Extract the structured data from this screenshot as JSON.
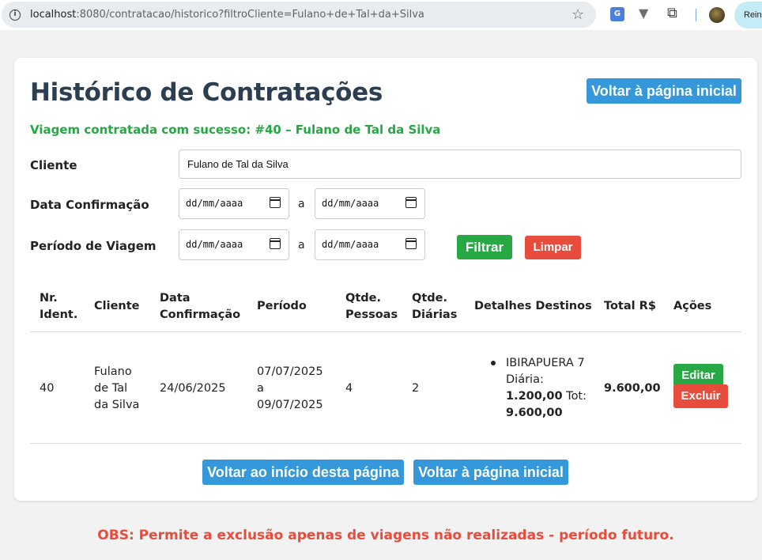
{
  "browser": {
    "url_host": "localhost",
    "url_rest": ":8080/contratacao/historico?filtroCliente=Fulano+de+Tal+da+Silva",
    "profile_label": "Rein"
  },
  "page": {
    "title": "Histórico de Contratações",
    "back_home_label": "Voltar à página inicial",
    "success_message": "Viagem contratada com sucesso: #40 – Fulano de Tal da Silva"
  },
  "filters": {
    "cliente_label": "Cliente",
    "cliente_value": "Fulano de Tal da Silva",
    "data_confirmacao_label": "Data Confirmação",
    "periodo_label": "Período de Viagem",
    "date_placeholder": "dd/mm/aaaa",
    "range_separator": "a",
    "filtrar_label": "Filtrar",
    "limpar_label": "Limpar"
  },
  "table": {
    "headers": [
      [
        "Nr.",
        "Ident."
      ],
      [
        "Cliente"
      ],
      [
        "Data",
        "Confirmação"
      ],
      [
        "Período"
      ],
      [
        "Qtde.",
        "Pessoas"
      ],
      [
        "Qtde.",
        "Diárias"
      ],
      [
        "Detalhes Destinos"
      ],
      [
        "Total R$"
      ],
      [
        "Ações"
      ]
    ],
    "rows": [
      {
        "id": "40",
        "cliente": [
          "Fulano",
          "de Tal",
          "da Silva"
        ],
        "data_confirmacao": "24/06/2025",
        "periodo": [
          "07/07/2025",
          "a",
          "09/07/2025"
        ],
        "pessoas": "4",
        "diarias": "2",
        "destino_nome": "IBIRAPUERA 7",
        "destino_diaria_label": "Diária:",
        "destino_diaria_valor": "1.200,00",
        "destino_tot_label": "Tot:",
        "destino_tot_valor": "9.600,00",
        "total": "9.600,00",
        "editar_label": "Editar",
        "excluir_label": "Excluir"
      }
    ]
  },
  "footer": {
    "back_top_label": "Voltar ao início desta página",
    "back_home_label": "Voltar à página inicial",
    "obs": "OBS: Permite a exclusão apenas de viagens não realizadas - período futuro."
  },
  "colors": {
    "primary": "#3498db",
    "success": "#28a745",
    "danger": "#e74c3c",
    "title": "#2c3e50"
  }
}
